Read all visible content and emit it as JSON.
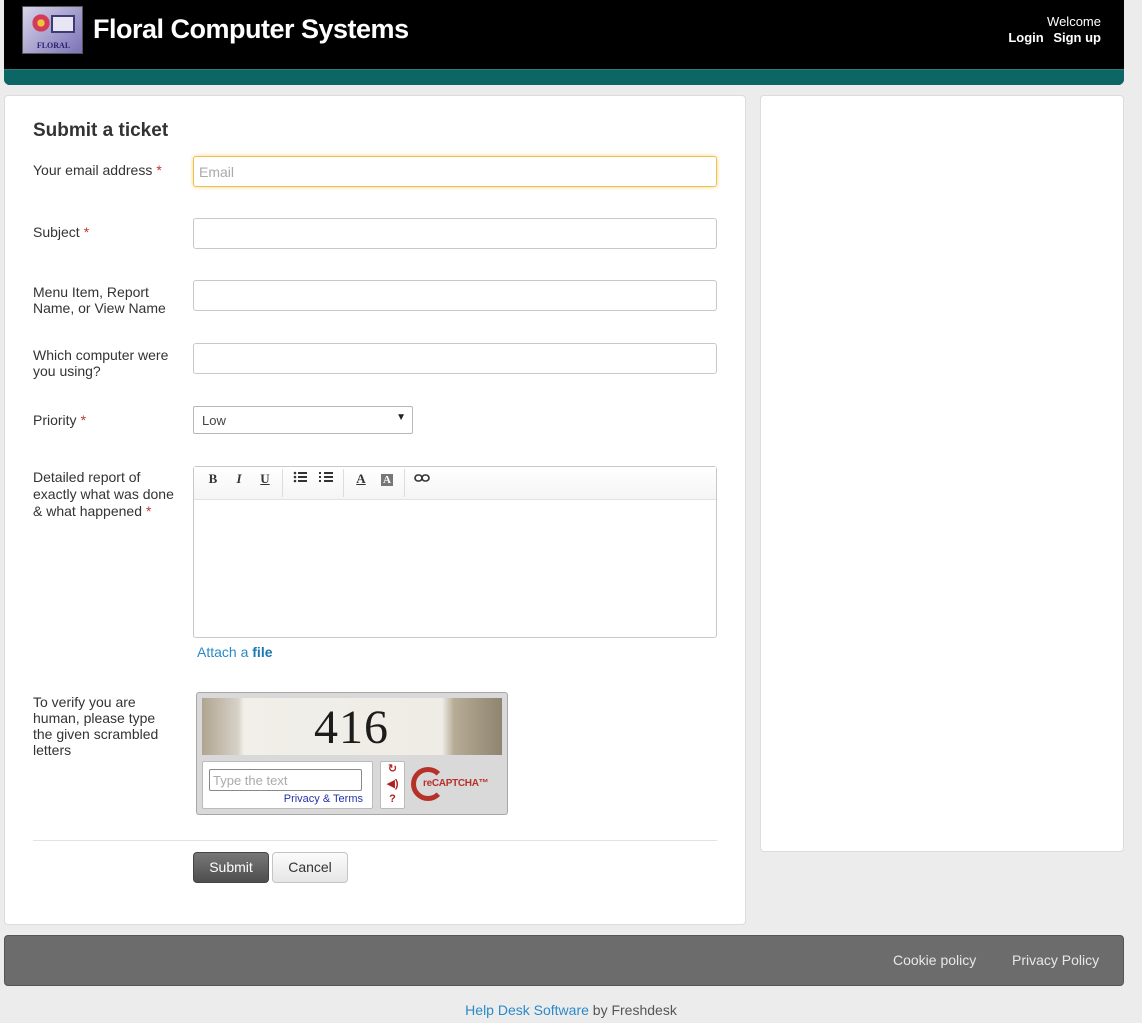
{
  "header": {
    "logo_text": "FLORAL",
    "brand": "Floral Computer Systems",
    "welcome": "Welcome",
    "login": "Login",
    "signup": "Sign up"
  },
  "form": {
    "title": "Submit a ticket",
    "email": {
      "label": "Your email address",
      "placeholder": "Email",
      "value": ""
    },
    "subject": {
      "label": "Subject",
      "value": ""
    },
    "menu_item": {
      "label": "Menu Item, Report Name, or View Name",
      "value": ""
    },
    "computer": {
      "label": "Which computer were you using?",
      "value": ""
    },
    "priority": {
      "label": "Priority",
      "value": "Low"
    },
    "details": {
      "label": "Detailed report of exactly what was done & what happened"
    },
    "toolbar": [
      "B",
      "I",
      "U",
      "bulleted-list",
      "numbered-list",
      "text-color",
      "background-color",
      "link"
    ],
    "attach_prefix": "Attach a",
    "attach_link": "file",
    "captcha": {
      "label": "To verify you are human, please type the given scrambled letters",
      "image_text": "416",
      "placeholder": "Type the text",
      "links": "Privacy & Terms",
      "brand": "reCAPTCHA™"
    },
    "submit": "Submit",
    "cancel": "Cancel"
  },
  "footer": {
    "cookie": "Cookie policy",
    "privacy": "Privacy Policy",
    "powered_link": "Help Desk Software",
    "powered_suffix": "by Freshdesk"
  },
  "colors": {
    "header_bg": "#000000",
    "teal": "#0b6664",
    "link": "#2a8ac7",
    "required": "#c0392b",
    "footer_bg": "#6c6c6c"
  }
}
